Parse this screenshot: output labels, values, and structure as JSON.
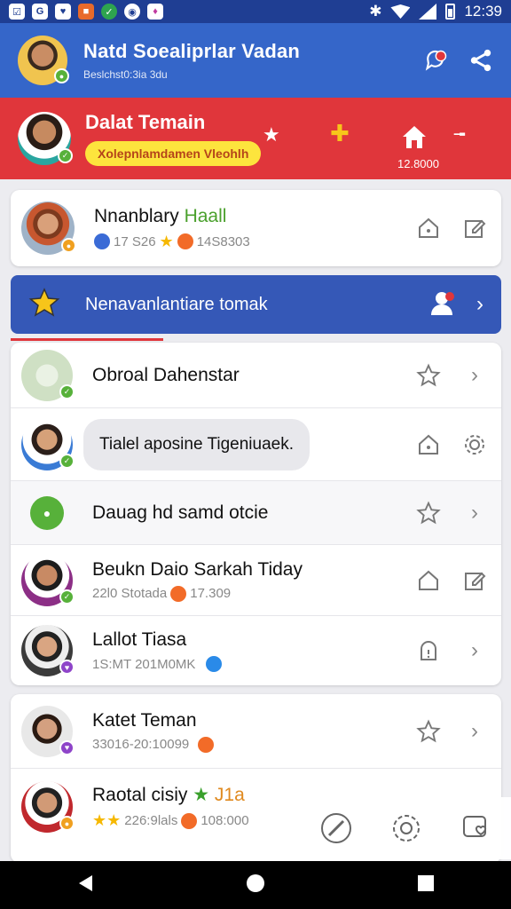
{
  "status": {
    "time": "12:39"
  },
  "header": {
    "title": "Natd Soealiprlar Vadan",
    "subtitle": "Beslchst0:3ia 3du"
  },
  "banner": {
    "title": "Dalat Temain",
    "pill": "Xolepnlamdamen Vleohlh",
    "count": "12.8000"
  },
  "top_item": {
    "name": "Nnanblary",
    "name_accent": "Haall",
    "meta_a": "17 S26",
    "meta_b": "14S8303"
  },
  "blue_bar": {
    "label": "Nenavanlantiare tomak"
  },
  "list1": [
    {
      "name": "Obroal Dahenstar",
      "meta": ""
    },
    {
      "name": "",
      "bubble": "Tialel aposine Tigeniuaek."
    },
    {
      "name": "Dauag hd samd otcie",
      "meta": ""
    },
    {
      "name": "Beukn Daio Sarkah Tiday",
      "meta_a": "22l0 Stotada",
      "meta_b": "17.309"
    },
    {
      "name": "Lallot Tiasa",
      "meta_a": "1S:MT 201M0MK"
    }
  ],
  "list2": [
    {
      "name": "Katet Teman",
      "meta_a": "33016-20:10099"
    },
    {
      "name": "Raotal cisiy",
      "name_accent": "J1a",
      "meta_a": "226:9lals",
      "meta_b": "108:000"
    }
  ],
  "colors": {
    "primary": "#3566c9",
    "status": "#1f3e93",
    "danger": "#e0363b",
    "accent_yellow": "#fde43d",
    "online": "#57b13a",
    "purple": "#8e44c9",
    "orange": "#f0a020"
  }
}
